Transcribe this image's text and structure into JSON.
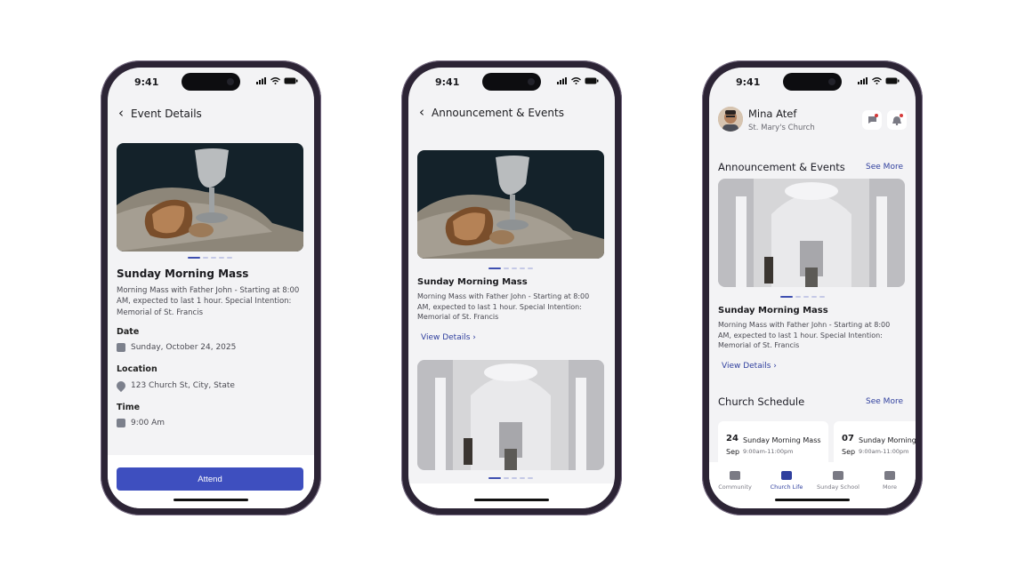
{
  "status": {
    "time": "9:41"
  },
  "screen1": {
    "header_title": "Event Details",
    "event_title": "Sunday Morning Mass",
    "event_description": "Morning Mass with Father John - Starting at 8:00 AM, expected to last 1 hour. Special Intention: Memorial of St. Francis",
    "date_label": "Date",
    "date_value": "Sunday, October 24, 2025",
    "location_label": "Location",
    "location_value": "123 Church St, City, State",
    "time_label": "Time",
    "time_value": "9:00 Am",
    "attend_label": "Attend"
  },
  "screen2": {
    "header_title": "Announcement & Events",
    "card_title": "Sunday Morning Mass",
    "card_description": "Morning Mass with Father John - Starting at 8:00 AM, expected to last 1 hour. Special Intention: Memorial of St. Francis",
    "view_details": "View Details"
  },
  "screen3": {
    "user_name": "Mina Atef",
    "church": "St. Mary's Church",
    "announcements_title": "Announcement & Events",
    "see_more": "See More",
    "card_title": "Sunday Morning Mass",
    "card_description": "Morning Mass with Father John - Starting at 8:00 AM, expected to last 1 hour. Special Intention: Memorial of St. Francis",
    "view_details": "View Details",
    "schedule_title": "Church Schedule",
    "schedule": [
      {
        "day": "24",
        "month": "Sep",
        "name": "Sunday Morning Mass",
        "hours": "9:00am-11:00pm"
      },
      {
        "day": "07",
        "month": "Sep",
        "name": "Sunday Morning",
        "hours": "9:00am-11:00pm"
      }
    ],
    "tabs": [
      {
        "label": "Community",
        "icon": "people-icon"
      },
      {
        "label": "Church Life",
        "icon": "church-icon"
      },
      {
        "label": "Sunday School",
        "icon": "book-icon"
      },
      {
        "label": "More",
        "icon": "menu-icon"
      }
    ],
    "active_tab": "Church Life"
  },
  "colors": {
    "accent": "#3E4FBF",
    "link": "#2F3F9E",
    "frame": "#2C2435",
    "screen_bg": "#F3F3F5"
  }
}
